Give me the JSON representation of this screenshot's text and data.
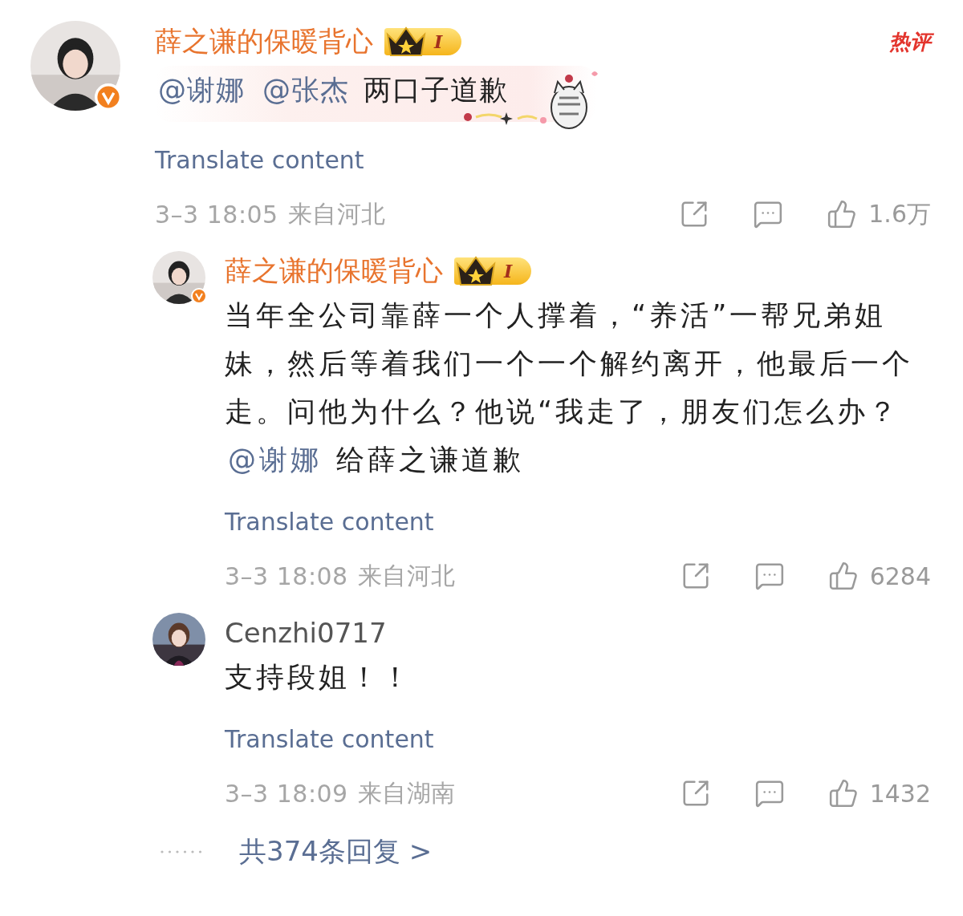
{
  "comment": {
    "author": "薛之谦的保暖背心",
    "verified": true,
    "badge": "I",
    "hot_label": "热评",
    "bubble": true,
    "content": [
      {
        "kind": "mention",
        "text": "@谢娜"
      },
      {
        "kind": "mention",
        "text": "@张杰"
      },
      {
        "kind": "text",
        "text": "两口子道歉"
      }
    ],
    "translate": "Translate content",
    "time": "3–3 18:05",
    "location": "来自河北",
    "likes": "1.6万"
  },
  "replies": [
    {
      "author": "薛之谦的保暖背心",
      "verified": true,
      "badge": "I",
      "bubble": false,
      "content": [
        {
          "kind": "text",
          "text": "当年全公司靠薛一个人撑着，“养活”一帮兄弟姐妹，然后等着我们一个一个解约离开，他最后一个走。问他为什么？他说“我走了，朋友们怎么办？"
        },
        {
          "kind": "mention",
          "text": "@谢娜"
        },
        {
          "kind": "text",
          "text": "给薛之谦道歉"
        }
      ],
      "translate": "Translate content",
      "time": "3–3 18:08",
      "location": "来自河北",
      "likes": "6284"
    },
    {
      "author": "Cenzhi0717",
      "verified": false,
      "bubble": false,
      "content": [
        {
          "kind": "text",
          "text": "支持段姐！！"
        }
      ],
      "translate": "Translate content",
      "time": "3–3 18:09",
      "location": "来自湖南",
      "likes": "1432"
    }
  ],
  "more_replies": "共374条回复 >"
}
